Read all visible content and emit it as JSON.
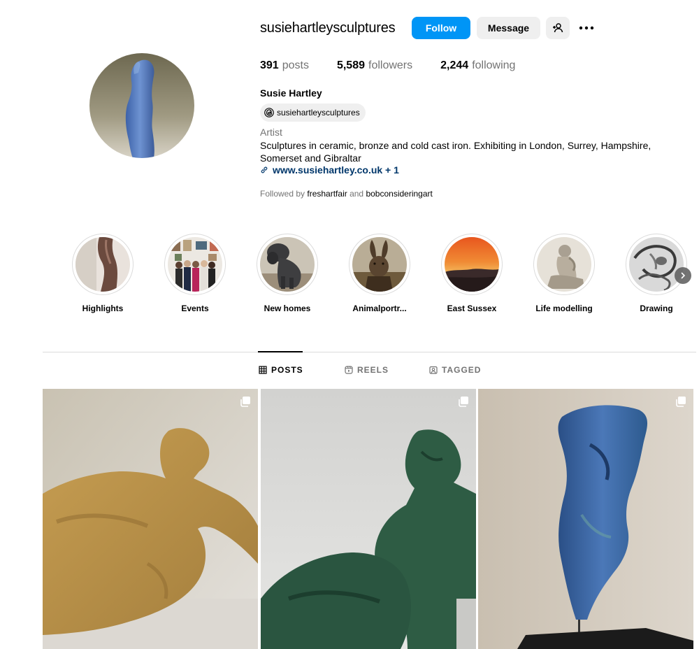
{
  "profile": {
    "username": "susiehartleysculptures",
    "follow_label": "Follow",
    "message_label": "Message",
    "posts_count": "391",
    "posts_label": "posts",
    "followers_count": "5,589",
    "followers_label": "followers",
    "following_count": "2,244",
    "following_label": "following",
    "full_name": "Susie Hartley",
    "threads_handle": "susiehartleysculptures",
    "category": "Artist",
    "bio": "Sculptures in ceramic, bronze and cold cast iron. Exhibiting in London, Surrey, Hampshire, Somerset and Gibraltar",
    "link": "www.susiehartley.co.uk + 1",
    "followed_by_prefix": "Followed by",
    "followed_by_1": "freshartfair",
    "followed_by_and": "and",
    "followed_by_2": "bobconsideringart"
  },
  "highlights": [
    {
      "label": "Highlights"
    },
    {
      "label": "Events"
    },
    {
      "label": "New homes"
    },
    {
      "label": "Animalportr..."
    },
    {
      "label": "East Sussex"
    },
    {
      "label": "Life modelling"
    },
    {
      "label": "Drawing"
    }
  ],
  "tabs": {
    "posts": "POSTS",
    "reels": "REELS",
    "tagged": "TAGGED"
  },
  "colors": {
    "accent": "#0095f6",
    "link": "#00376b",
    "secondary_text": "#737373"
  }
}
